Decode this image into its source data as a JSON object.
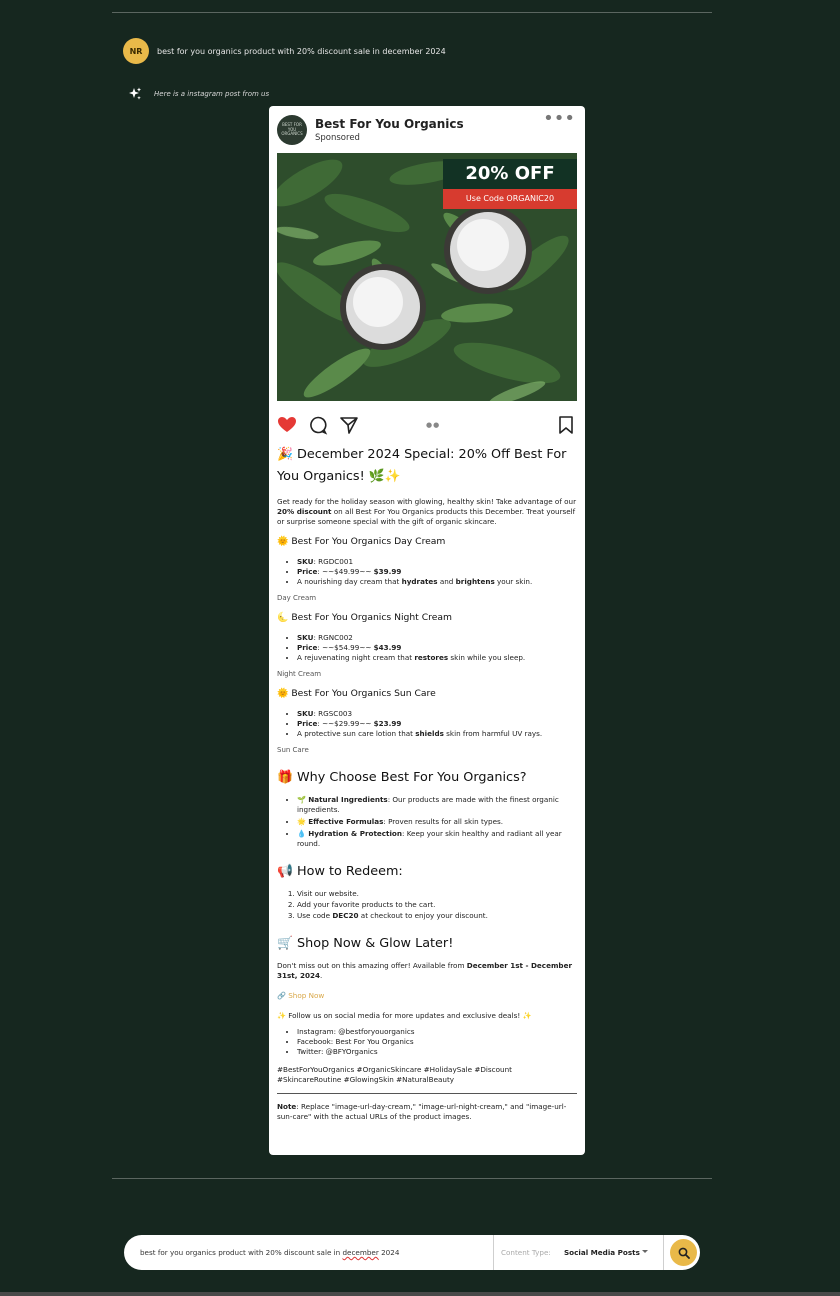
{
  "user": {
    "avatar_initials": "NR",
    "message": "best for you organics product with 20% discount sale in december 2024"
  },
  "ai": {
    "message": "Here is a instagram post from us"
  },
  "post": {
    "brand_logo_text": "BEST FOR YOU ORGANICS",
    "brand_name": "Best For You Organics",
    "sponsored": "Sponsored",
    "badge_title": "20% OFF",
    "badge_code": "Use Code ORGANIC20",
    "title": "🎉 December 2024 Special: 20% Off Best For You Organics! 🌿✨",
    "intro_pre": "Get ready for the holiday season with glowing, healthy skin! Take advantage of our ",
    "intro_bold": "20% discount",
    "intro_post": " on all Best For You Organics products this December. Treat yourself or surprise someone special with the gift of organic skincare.",
    "products": [
      {
        "heading": "🌞 Best For You Organics Day Cream",
        "sku_label": "SKU",
        "sku": ": RGDC001",
        "price_label": "Price",
        "price_old": ": ~~$49.99~~ ",
        "price_new": "$39.99",
        "desc_pre": "A nourishing day cream that ",
        "desc_b1": "hydrates",
        "desc_mid": " and ",
        "desc_b2": "brightens",
        "desc_post": " your skin.",
        "img_alt": "Day Cream"
      },
      {
        "heading": "🌜 Best For You Organics Night Cream",
        "sku_label": "SKU",
        "sku": ": RGNC002",
        "price_label": "Price",
        "price_old": ": ~~$54.99~~ ",
        "price_new": "$43.99",
        "desc_pre": "A rejuvenating night cream that ",
        "desc_b1": "restores",
        "desc_post": " skin while you sleep.",
        "img_alt": "Night Cream"
      },
      {
        "heading": "🌞 Best For You Organics Sun Care",
        "sku_label": "SKU",
        "sku": ": RGSC003",
        "price_label": "Price",
        "price_old": ": ~~$29.99~~ ",
        "price_new": "$23.99",
        "desc_pre": "A protective sun care lotion that ",
        "desc_b1": "shields",
        "desc_post": " skin from harmful UV rays.",
        "img_alt": "Sun Care"
      }
    ],
    "why_heading": "🎁 Why Choose Best For You Organics?",
    "why_items": [
      {
        "icon": "🌱 ",
        "bold": "Natural Ingredients",
        "text": ": Our products are made with the finest organic ingredients."
      },
      {
        "icon": "🌟 ",
        "bold": "Effective Formulas",
        "text": ": Proven results for all skin types."
      },
      {
        "icon": "💧 ",
        "bold": "Hydration & Protection",
        "text": ": Keep your skin healthy and radiant all year round."
      }
    ],
    "redeem_heading": "📢 How to Redeem:",
    "redeem_steps": [
      "Visit our website.",
      "Add your favorite products to the cart."
    ],
    "redeem_step3_pre": "Use code ",
    "redeem_step3_bold": "DEC20",
    "redeem_step3_post": " at checkout to enjoy your discount.",
    "shop_heading": "🛒 Shop Now & Glow Later!",
    "offer_pre": "Don't miss out on this amazing offer! Available from ",
    "offer_bold": "December 1st - December 31st, 2024",
    "offer_post": ".",
    "shop_link_icon": "🔗 ",
    "shop_link": "Shop Now",
    "follow": "✨ Follow us on social media for more updates and exclusive deals! ✨",
    "socials": [
      "Instagram: @bestforyouorganics",
      "Facebook: Best For You Organics",
      "Twitter: @BFYOrganics"
    ],
    "hashtags": "#BestForYouOrganics #OrganicSkincare #HolidaySale #Discount #SkincareRoutine #GlowingSkin #NaturalBeauty",
    "note_bold": "Note",
    "note_text": ": Replace \"image-url-day-cream,\" \"image-url-night-cream,\" and \"image-url-sun-care\" with the actual URLs of the product images."
  },
  "input": {
    "query_pre": "best for you organics product with 20% discount sale in ",
    "query_misspelled": "december",
    "query_post": " 2024",
    "type_label": "Content Type:",
    "type_value": "Social Media Posts"
  },
  "colors": {
    "background": "#16271f",
    "accent": "#e9b949",
    "badge_dark": "#123224",
    "badge_red": "#d73b2f",
    "heart": "#e53935"
  }
}
